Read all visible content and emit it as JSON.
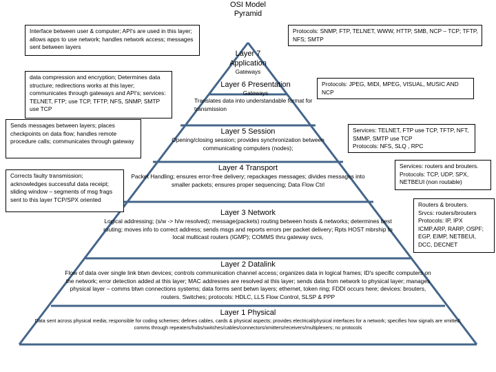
{
  "page": {
    "title": "OSI Model\nPyramid",
    "accent_color": "#44658a",
    "border_color": "#000000",
    "background_color": "#ffffff"
  },
  "layers": [
    {
      "id": "layer-7",
      "title": "Layer 7\nApplication",
      "subtitle": "Gateways",
      "description": "",
      "left_note": "Interface between user & computer; API's are used in this layer; allows apps to use network; handles network access; messages sent between layers",
      "right_note": "Protocols:  SNMP, FTP, TELNET, WWW, HTTP, SMB, NCP – TCP; TFTP, NFS; SMTP"
    },
    {
      "id": "layer-6",
      "title": "Layer 6 Presentation",
      "subtitle": "Gateways",
      "description": "Translates data into understandable format for transmission",
      "left_note": "data compression and encryption; Determines data structure; redirections works at this layer; communicates through gateways and API's; services:  TELNET, FTP; use TCP, TFTP, NFS, SNMP, SMTP use TCP",
      "right_note": "Protocols:  JPEG, MIDI, MPEG, VISUAL, MUSIC AND NCP"
    },
    {
      "id": "layer-5",
      "title": "Layer 5 Session",
      "subtitle": "",
      "description": "Opening/closing session; provides synchronization between communicating computers (nodes);",
      "left_note": "Sends messages between layers; places checkpoints on data flow; handles remote procedure calls; communicates through gateway",
      "right_note": "Services:  TELNET, FTP use TCP, TFTP, NFT, SMMP, SMTP use TCP\nProtocols:  NFS, SLQ , RPC"
    },
    {
      "id": "layer-4",
      "title": "Layer 4 Transport",
      "subtitle": "",
      "description": "Packet Handling; ensures error-free delivery; repackages messages; divides messages into smaller packets; ensures proper sequencing;  Data Flow Ctrl",
      "left_note": "Corrects faulty transmission; acknowledges successful data receipt; sliding window – segments of msg frags sent to this layer TCP/SPX oriented",
      "right_note": "Services: routers and brouters. Protocols: TCP, UDP, SPX, NETBEUI (non routable)"
    },
    {
      "id": "layer-3",
      "title": "Layer 3 Network",
      "subtitle": "",
      "description": "Logical addressing; (s/w -> h/w resolved); message(packets) routing between hosts & networks; determines best routing; moves info to correct address; sends msgs and reports errors per packet delivery; Rpts  HOST mbrship to local multicast routers (IGMP); COMMS thru gateway svcs,",
      "left_note": "",
      "right_note": "Routers & brouters.\nSrvcs:  routers/brouters\nProtocols:  IP, IPX\nICMP,ARP, RARP, OSPF; EGP, EIMP, NETBEUI, DCC, DECNET"
    },
    {
      "id": "layer-2",
      "title": "Layer 2 Datalink",
      "subtitle": "",
      "description": "Flow of data over single link btwn devices; controls communication channel access; organizes data in logical frames; ID's specific computers on the network; error detection added at this layer; MAC addresses are resolved at this  layer; sends data from network to physical layer; manages physical layer – comms btwn connections systems; data forms sent betwn layers; ethernet, token ring; FDDI occurs here; devices:  brouters,  routers. Switches; protocols:  HDLC, LLS Flow Control, SLSP & PPP",
      "left_note": "",
      "right_note": ""
    },
    {
      "id": "layer-1",
      "title": "Layer 1  Physical",
      "subtitle": "",
      "description": "Data sent across physical media; responsible for coding schemes; defines cables, cards & physical aspects; provides electrical/physical interfaces for a network; specifies how signals are xmitted; comms through repeaters/hubs/switches/cables/connectors/xmitters/receivers/multiplexers; no protocols",
      "left_note": "",
      "right_note": ""
    }
  ]
}
